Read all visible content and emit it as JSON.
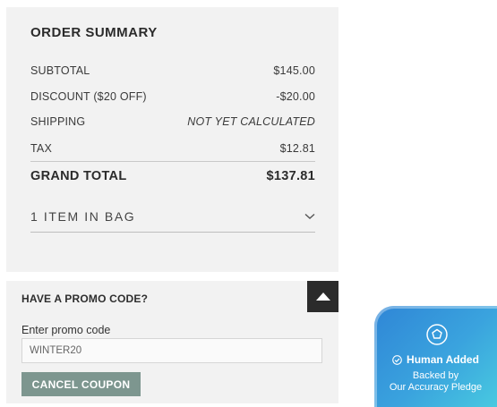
{
  "order_summary": {
    "title": "ORDER SUMMARY",
    "rows": [
      {
        "label": "SUBTOTAL",
        "value": "$145.00"
      },
      {
        "label": "DISCOUNT ($20 OFF)",
        "value": "-$20.00"
      },
      {
        "label": "SHIPPING",
        "value": "NOT YET CALCULATED"
      },
      {
        "label": "TAX",
        "value": "$12.81"
      }
    ],
    "grand_total": {
      "label": "GRAND TOTAL",
      "value": "$137.81"
    },
    "bag": {
      "label": "1 ITEM IN BAG",
      "icon": "chevron-down-icon"
    }
  },
  "promo": {
    "title": "HAVE A PROMO CODE?",
    "toggle_icon": "caret-up-icon",
    "input_label": "Enter promo code",
    "input_value": "WINTER20",
    "cancel_label": "CANCEL COUPON"
  },
  "badge": {
    "icon": "shield-icon",
    "check_icon": "check-circle-icon",
    "headline": "Human Added",
    "line1": "Backed by",
    "line2": "Our Accuracy Pledge",
    "colors": {
      "start": "#2f86d6",
      "end": "#48c9e0"
    }
  },
  "colors": {
    "panel_bg": "#f2f2f2",
    "button_bg": "#7d968f",
    "toggle_bg": "#2b2b2b"
  }
}
